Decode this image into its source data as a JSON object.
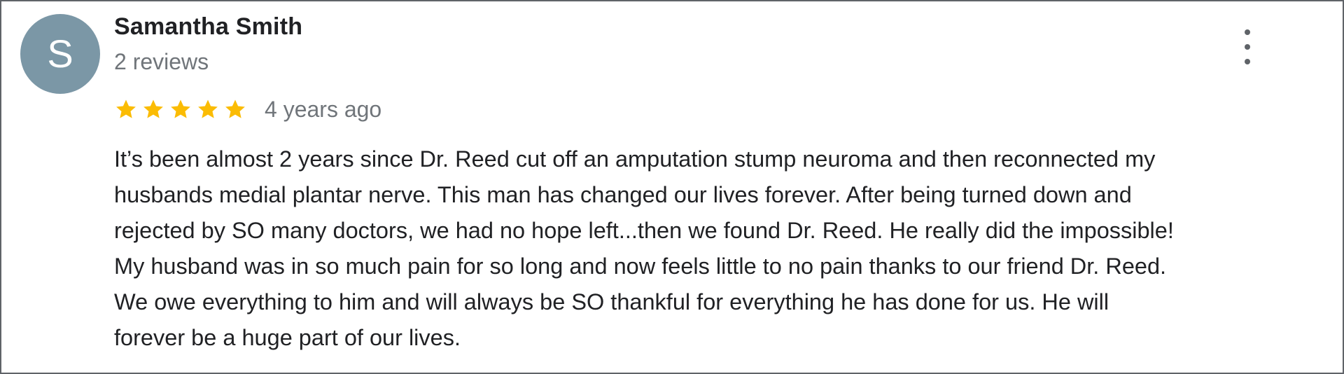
{
  "review": {
    "avatar_initial": "S",
    "reviewer_name": "Samantha Smith",
    "review_count": "2 reviews",
    "rating": 5,
    "rating_max": 5,
    "time_ago": "4 years ago",
    "text": "It’s been almost 2 years since Dr. Reed cut off an amputation stump neuroma and then reconnected my\nhusbands medial plantar nerve. This man has changed our lives forever. After being turned down and\nrejected by SO many doctors, we had no hope left...then we found Dr. Reed. He really did the impossible!\nMy husband was in so much pain for so long and now feels little to no pain thanks to our friend Dr. Reed.\nWe owe everything to him and will always be SO thankful for everything he has done for us. He will\nforever be a huge part of our lives."
  },
  "icons": {
    "more": "more-vert-icon",
    "star": "star-icon"
  },
  "colors": {
    "avatar_bg": "#7b97a6",
    "star": "#fbbc04",
    "secondary_text": "#70757a",
    "primary_text": "#202124"
  }
}
